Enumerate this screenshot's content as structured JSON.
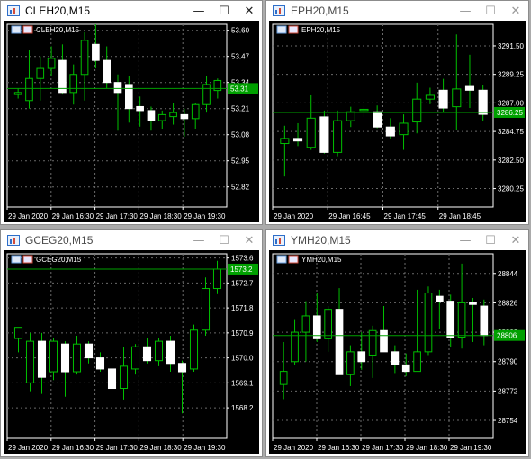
{
  "windows": [
    {
      "title": "CLEH20,M15",
      "active": true,
      "chart_label": "CLEH20,M15",
      "current_price": "53.31",
      "close_glyph": "✕",
      "minimize_glyph": "—",
      "maximize_glyph": "☐"
    },
    {
      "title": "EPH20,M15",
      "active": false,
      "chart_label": "EPH20,M15",
      "current_price": "3286.25",
      "close_glyph": "✕",
      "minimize_glyph": "—",
      "maximize_glyph": "☐"
    },
    {
      "title": "GCEG20,M15",
      "active": false,
      "chart_label": "GCEG20,M15",
      "current_price": "1573.2",
      "close_glyph": "✕",
      "minimize_glyph": "—",
      "maximize_glyph": "☐"
    },
    {
      "title": "YMH20,M15",
      "active": false,
      "chart_label": "YMH20,M15",
      "current_price": "28806",
      "close_glyph": "✕",
      "minimize_glyph": "—",
      "maximize_glyph": "☐"
    }
  ],
  "chart_data": [
    {
      "type": "candlestick",
      "title": "CLEH20,M15",
      "y_ticks": [
        "53.60",
        "53.47",
        "53.34",
        "53.21",
        "53.08",
        "52.95",
        "52.82"
      ],
      "x_ticks": [
        "29 Jan 2020",
        "29 Jan 16:30",
        "29 Jan 17:30",
        "29 Jan 18:30",
        "29 Jan 19:30"
      ],
      "ylim": [
        52.72,
        53.63
      ],
      "current_price": 53.31,
      "candles": [
        {
          "o": 53.28,
          "h": 53.31,
          "l": 53.26,
          "c": 53.29
        },
        {
          "o": 53.25,
          "h": 53.5,
          "l": 53.21,
          "c": 53.36
        },
        {
          "o": 53.36,
          "h": 53.47,
          "l": 53.25,
          "c": 53.41
        },
        {
          "o": 53.41,
          "h": 53.52,
          "l": 53.37,
          "c": 53.46
        },
        {
          "o": 53.45,
          "h": 53.53,
          "l": 53.28,
          "c": 53.29
        },
        {
          "o": 53.29,
          "h": 53.43,
          "l": 53.23,
          "c": 53.38
        },
        {
          "o": 53.38,
          "h": 53.59,
          "l": 53.25,
          "c": 53.55
        },
        {
          "o": 53.53,
          "h": 53.63,
          "l": 53.41,
          "c": 53.45
        },
        {
          "o": 53.45,
          "h": 53.52,
          "l": 53.31,
          "c": 53.34
        },
        {
          "o": 53.34,
          "h": 53.38,
          "l": 53.1,
          "c": 53.29
        },
        {
          "o": 53.33,
          "h": 53.37,
          "l": 53.14,
          "c": 53.21
        },
        {
          "o": 53.22,
          "h": 53.27,
          "l": 53.12,
          "c": 53.2
        },
        {
          "o": 53.2,
          "h": 53.22,
          "l": 53.1,
          "c": 53.15
        },
        {
          "o": 53.15,
          "h": 53.2,
          "l": 53.11,
          "c": 53.18
        },
        {
          "o": 53.17,
          "h": 53.24,
          "l": 53.13,
          "c": 53.19
        },
        {
          "o": 53.18,
          "h": 53.21,
          "l": 53.07,
          "c": 53.16
        },
        {
          "o": 53.16,
          "h": 53.24,
          "l": 53.11,
          "c": 53.23
        },
        {
          "o": 53.23,
          "h": 53.37,
          "l": 53.19,
          "c": 53.33
        },
        {
          "o": 53.3,
          "h": 53.36,
          "l": 53.26,
          "c": 53.35
        }
      ]
    },
    {
      "type": "candlestick",
      "title": "EPH20,M15",
      "y_ticks": [
        "3291.50",
        "3289.25",
        "3287.00",
        "3284.75",
        "3282.50",
        "3280.25"
      ],
      "x_ticks": [
        "29 Jan 2020",
        "29 Jan 16:45",
        "29 Jan 17:45",
        "29 Jan 18:45"
      ],
      "ylim": [
        3278.8,
        3293.2
      ],
      "current_price": 3286.25,
      "candles": [
        {
          "o": 3283.8,
          "h": 3285.2,
          "l": 3281.2,
          "c": 3284.2
        },
        {
          "o": 3284.2,
          "h": 3285.4,
          "l": 3283.6,
          "c": 3284.0
        },
        {
          "o": 3283.5,
          "h": 3287.6,
          "l": 3283.3,
          "c": 3285.8
        },
        {
          "o": 3285.9,
          "h": 3286.4,
          "l": 3283.0,
          "c": 3283.1
        },
        {
          "o": 3283.1,
          "h": 3286.4,
          "l": 3282.8,
          "c": 3285.6
        },
        {
          "o": 3285.6,
          "h": 3286.7,
          "l": 3285.1,
          "c": 3286.3
        },
        {
          "o": 3286.4,
          "h": 3286.8,
          "l": 3285.9,
          "c": 3286.5
        },
        {
          "o": 3286.3,
          "h": 3286.8,
          "l": 3285.0,
          "c": 3285.1
        },
        {
          "o": 3285.1,
          "h": 3285.8,
          "l": 3284.2,
          "c": 3284.4
        },
        {
          "o": 3284.5,
          "h": 3286.1,
          "l": 3283.3,
          "c": 3285.4
        },
        {
          "o": 3285.5,
          "h": 3288.6,
          "l": 3284.6,
          "c": 3287.3
        },
        {
          "o": 3287.3,
          "h": 3288.2,
          "l": 3286.9,
          "c": 3287.6
        },
        {
          "o": 3288.0,
          "h": 3288.9,
          "l": 3286.3,
          "c": 3286.6
        },
        {
          "o": 3286.7,
          "h": 3292.4,
          "l": 3284.9,
          "c": 3288.1
        },
        {
          "o": 3288.3,
          "h": 3290.8,
          "l": 3286.6,
          "c": 3288.0
        },
        {
          "o": 3288.0,
          "h": 3288.4,
          "l": 3285.6,
          "c": 3286.1
        }
      ]
    },
    {
      "type": "candlestick",
      "title": "GCEG20,M15",
      "y_ticks": [
        "1573.6",
        "1572.7",
        "1571.8",
        "1570.9",
        "1570.0",
        "1569.1",
        "1568.2"
      ],
      "x_ticks": [
        "29 Jan 2020",
        "29 Jan 16:30",
        "29 Jan 17:30",
        "29 Jan 18:30",
        "29 Jan 19:30"
      ],
      "ylim": [
        1567.1,
        1573.75
      ],
      "current_price": 1573.2,
      "candles": [
        {
          "o": 1570.7,
          "h": 1570.9,
          "l": 1570.2,
          "c": 1571.1
        },
        {
          "o": 1569.1,
          "h": 1570.9,
          "l": 1568.8,
          "c": 1570.6
        },
        {
          "o": 1570.6,
          "h": 1570.9,
          "l": 1568.7,
          "c": 1569.3
        },
        {
          "o": 1569.5,
          "h": 1570.7,
          "l": 1569.2,
          "c": 1570.6
        },
        {
          "o": 1570.5,
          "h": 1570.6,
          "l": 1568.6,
          "c": 1569.5
        },
        {
          "o": 1569.5,
          "h": 1570.8,
          "l": 1569.4,
          "c": 1570.5
        },
        {
          "o": 1570.5,
          "h": 1570.6,
          "l": 1569.8,
          "c": 1570.0
        },
        {
          "o": 1570.0,
          "h": 1570.2,
          "l": 1569.5,
          "c": 1569.6
        },
        {
          "o": 1569.6,
          "h": 1569.7,
          "l": 1568.6,
          "c": 1568.9
        },
        {
          "o": 1568.9,
          "h": 1570.4,
          "l": 1568.5,
          "c": 1569.7
        },
        {
          "o": 1569.6,
          "h": 1570.5,
          "l": 1569.4,
          "c": 1570.4
        },
        {
          "o": 1570.4,
          "h": 1570.7,
          "l": 1569.8,
          "c": 1569.9
        },
        {
          "o": 1569.9,
          "h": 1570.7,
          "l": 1569.7,
          "c": 1570.6
        },
        {
          "o": 1570.6,
          "h": 1570.8,
          "l": 1569.5,
          "c": 1569.8
        },
        {
          "o": 1569.8,
          "h": 1569.9,
          "l": 1568.0,
          "c": 1569.5
        },
        {
          "o": 1569.6,
          "h": 1571.2,
          "l": 1569.5,
          "c": 1571.0
        },
        {
          "o": 1571.0,
          "h": 1572.9,
          "l": 1570.8,
          "c": 1572.5
        },
        {
          "o": 1572.5,
          "h": 1573.5,
          "l": 1572.3,
          "c": 1573.2
        }
      ]
    },
    {
      "type": "candlestick",
      "title": "YMH20,M15",
      "y_ticks": [
        "28844",
        "28826",
        "28808",
        "28790",
        "28772",
        "28754"
      ],
      "x_ticks": [
        "29 Jan 2020",
        "29 Jan 16:30",
        "29 Jan 17:30",
        "29 Jan 18:30",
        "29 Jan 19:30"
      ],
      "ylim": [
        28743,
        28856
      ],
      "current_price": 28806,
      "candles": [
        {
          "o": 28776,
          "h": 28802,
          "l": 28767,
          "c": 28784
        },
        {
          "o": 28790,
          "h": 28816,
          "l": 28788,
          "c": 28808
        },
        {
          "o": 28808,
          "h": 28827,
          "l": 28790,
          "c": 28818
        },
        {
          "o": 28818,
          "h": 28832,
          "l": 28802,
          "c": 28804
        },
        {
          "o": 28804,
          "h": 28824,
          "l": 28796,
          "c": 28822
        },
        {
          "o": 28822,
          "h": 28835,
          "l": 28786,
          "c": 28782
        },
        {
          "o": 28782,
          "h": 28800,
          "l": 28775,
          "c": 28796
        },
        {
          "o": 28796,
          "h": 28808,
          "l": 28785,
          "c": 28790
        },
        {
          "o": 28794,
          "h": 28812,
          "l": 28780,
          "c": 28809
        },
        {
          "o": 28809,
          "h": 28824,
          "l": 28798,
          "c": 28796
        },
        {
          "o": 28796,
          "h": 28800,
          "l": 28783,
          "c": 28788
        },
        {
          "o": 28788,
          "h": 28795,
          "l": 28781,
          "c": 28784
        },
        {
          "o": 28784,
          "h": 28834,
          "l": 28786,
          "c": 28796
        },
        {
          "o": 28796,
          "h": 28836,
          "l": 28794,
          "c": 28832
        },
        {
          "o": 28830,
          "h": 28834,
          "l": 28810,
          "c": 28827
        },
        {
          "o": 28827,
          "h": 28831,
          "l": 28799,
          "c": 28805
        },
        {
          "o": 28805,
          "h": 28850,
          "l": 28798,
          "c": 28826
        },
        {
          "o": 28826,
          "h": 28829,
          "l": 28802,
          "c": 28825
        },
        {
          "o": 28824,
          "h": 28828,
          "l": 28800,
          "c": 28806
        }
      ]
    }
  ]
}
